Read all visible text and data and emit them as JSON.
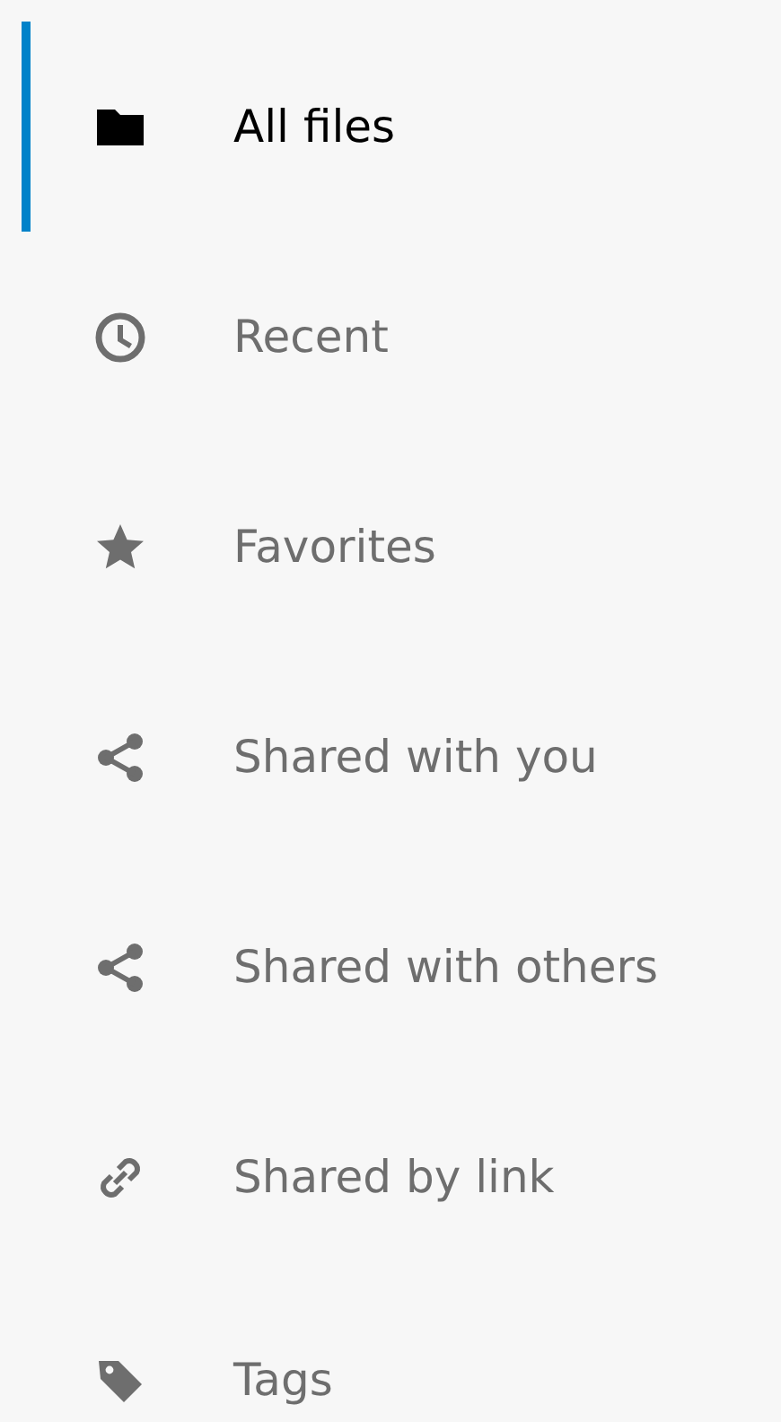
{
  "sidebar": {
    "items": [
      {
        "kind": "folder",
        "label": "All files",
        "selected": true
      },
      {
        "kind": "clock",
        "label": "Recent",
        "selected": false
      },
      {
        "kind": "star",
        "label": "Favorites",
        "selected": false
      },
      {
        "kind": "share",
        "label": "Shared with you",
        "selected": false
      },
      {
        "kind": "share",
        "label": "Shared with others",
        "selected": false
      },
      {
        "kind": "link",
        "label": "Shared by link",
        "selected": false
      },
      {
        "kind": "tag",
        "label": "Tags",
        "selected": false
      }
    ]
  }
}
